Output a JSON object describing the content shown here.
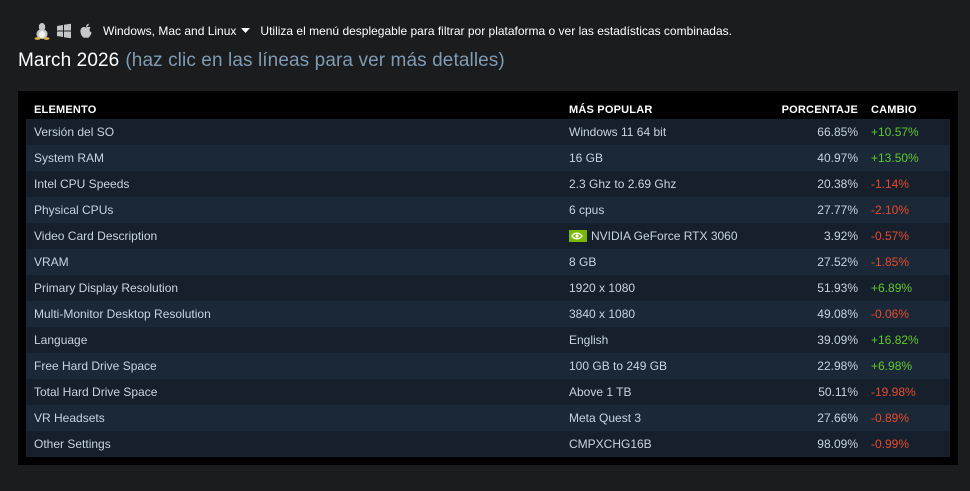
{
  "platform_filter": {
    "selected": "Windows, Mac and Linux",
    "hint": "Utiliza el menú desplegable para filtrar por plataforma o ver las estadísticas combinadas.",
    "icons": [
      "linux-icon",
      "windows-icon",
      "apple-icon",
      "chevron-down-icon"
    ]
  },
  "title": {
    "month": "March 2026",
    "hint": "(haz clic en las líneas para ver más detalles)"
  },
  "table": {
    "headers": {
      "elemento": "ELEMENTO",
      "popular": "MÁS POPULAR",
      "porcentaje": "PORCENTAJE",
      "cambio": "CAMBIO"
    },
    "rows": [
      {
        "elemento": "Versión del SO",
        "popular": "Windows 11 64 bit",
        "porcentaje": "66.85%",
        "cambio": "+10.57%",
        "trend": "up"
      },
      {
        "elemento": "System RAM",
        "popular": "16 GB",
        "porcentaje": "40.97%",
        "cambio": "+13.50%",
        "trend": "up"
      },
      {
        "elemento": "Intel CPU Speeds",
        "popular": "2.3 Ghz to 2.69 Ghz",
        "porcentaje": "20.38%",
        "cambio": "-1.14%",
        "trend": "down"
      },
      {
        "elemento": "Physical CPUs",
        "popular": "6 cpus",
        "porcentaje": "27.77%",
        "cambio": "-2.10%",
        "trend": "down"
      },
      {
        "elemento": "Video Card Description",
        "popular": "NVIDIA GeForce RTX 3060",
        "porcentaje": "3.92%",
        "cambio": "-0.57%",
        "trend": "down",
        "icon": "nvidia-icon"
      },
      {
        "elemento": "VRAM",
        "popular": "8 GB",
        "porcentaje": "27.52%",
        "cambio": "-1.85%",
        "trend": "down"
      },
      {
        "elemento": "Primary Display Resolution",
        "popular": "1920 x 1080",
        "porcentaje": "51.93%",
        "cambio": "+6.89%",
        "trend": "up"
      },
      {
        "elemento": "Multi-Monitor Desktop Resolution",
        "popular": "3840 x 1080",
        "porcentaje": "49.08%",
        "cambio": "-0.06%",
        "trend": "down"
      },
      {
        "elemento": "Language",
        "popular": "English",
        "porcentaje": "39.09%",
        "cambio": "+16.82%",
        "trend": "up"
      },
      {
        "elemento": "Free Hard Drive Space",
        "popular": "100 GB to 249 GB",
        "porcentaje": "22.98%",
        "cambio": "+6.98%",
        "trend": "up"
      },
      {
        "elemento": "Total Hard Drive Space",
        "popular": "Above 1 TB",
        "porcentaje": "50.11%",
        "cambio": "-19.98%",
        "trend": "down"
      },
      {
        "elemento": "VR Headsets",
        "popular": "Meta Quest 3",
        "porcentaje": "27.66%",
        "cambio": "-0.89%",
        "trend": "down"
      },
      {
        "elemento": "Other Settings",
        "popular": "CMPXCHG16B",
        "porcentaje": "98.09%",
        "cambio": "-0.99%",
        "trend": "down"
      }
    ]
  },
  "colors": {
    "background": "#1b1c1e",
    "panel": "#000000",
    "row_odd": "#16202d",
    "row_even": "#1b2838",
    "positive": "#5fc82d",
    "negative": "#e34b2c",
    "hint_text": "#7f9bb3"
  }
}
